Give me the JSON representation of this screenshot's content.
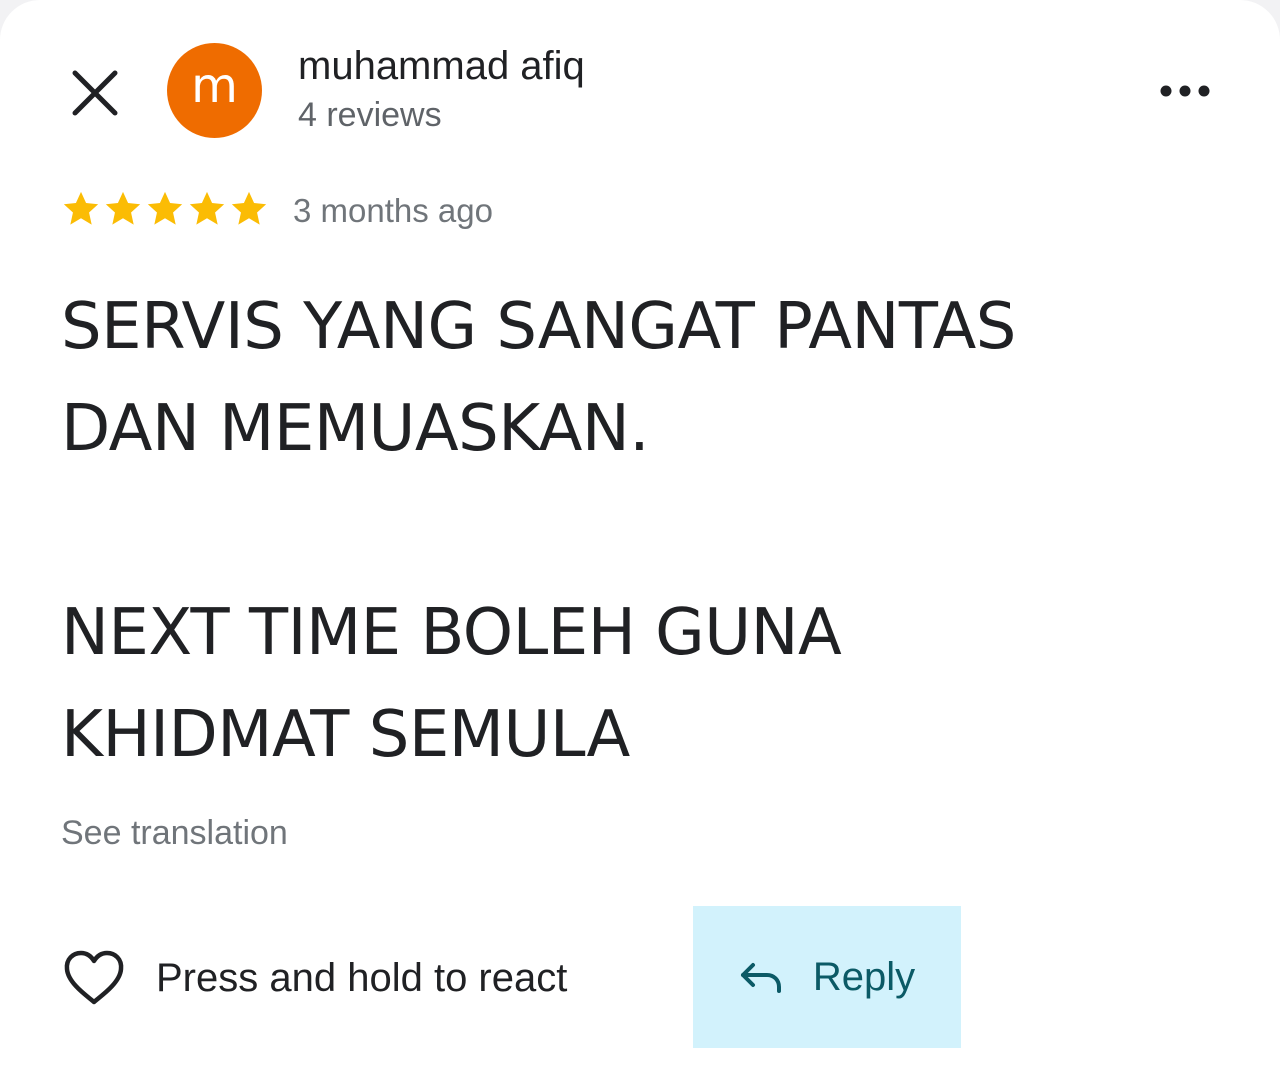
{
  "reviewer": {
    "avatar_letter": "m",
    "avatar_color": "#ef6c00",
    "name": "muhammad afiq",
    "review_count": "4 reviews"
  },
  "rating": {
    "stars": 5,
    "max_stars": 5,
    "star_color": "#fbbc04"
  },
  "review": {
    "time_ago": "3 months ago",
    "paragraphs": [
      [
        "SERVIS YANG SANGAT PANTAS",
        "DAN MEMUASKAN."
      ],
      [
        "NEXT TIME BOLEH GUNA",
        "KHIDMAT SEMULA"
      ]
    ],
    "see_translation": "See translation"
  },
  "actions": {
    "react_label": "Press and hold to react",
    "reply_label": "Reply",
    "reply_bg_color": "#d2f2fc",
    "reply_text_color": "#0b5a66"
  },
  "icons": {
    "close": "close-icon",
    "more": "more-horizontal-icon",
    "star": "star-icon",
    "heart": "heart-outline-icon",
    "reply": "reply-arrow-icon"
  }
}
